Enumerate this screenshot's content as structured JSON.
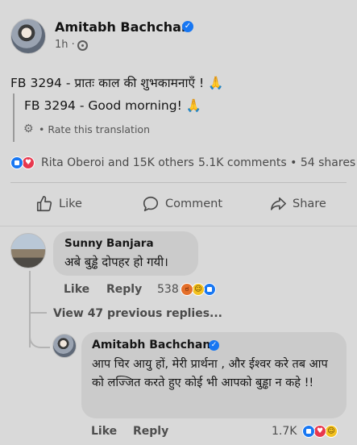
{
  "post": {
    "author": "Amitabh Bachchan",
    "time": "1h",
    "meta_separator": "·",
    "text": "FB 3294 - प्रातः काल की शुभकामनाएँ !",
    "emoji": "🙏",
    "translation": "FB 3294 - Good morning!",
    "rate_translation": "Rate this translation",
    "rate_separator": "•",
    "reactions_summary": "Rita Oberoi and 15K others",
    "comments_shares": "5.1K comments • 54 shares"
  },
  "actions": {
    "like": "Like",
    "comment": "Comment",
    "share": "Share"
  },
  "comment1": {
    "author": "Sunny Banjara",
    "text": "अबे बुड्ढे दोपहर हो गयी।",
    "like": "Like",
    "reply": "Reply",
    "reaction_count": "538"
  },
  "view_previous": "View 47 previous replies...",
  "reply1": {
    "author": "Amitabh Bachchan",
    "text": "आप  चिर आयु हों, मेरी प्रार्थना  , और ईश्वर करे तब आप को लज्जित करते हुए कोई भी आपको बुड्ढा न कहे  !!",
    "like": "Like",
    "reply": "Reply",
    "reaction_count": "1.7K"
  },
  "colors": {
    "background": "#d9d9d9",
    "bubble": "#cbcbcb",
    "accent_blue": "#1877f2",
    "love_red": "#e8384e",
    "haha_yellow": "#f3c11f",
    "angry_orange": "#e46f2a"
  },
  "icons": {
    "verified": "verified-badge-icon",
    "globe": "globe-icon",
    "gear": "gear-icon",
    "like": "thumbs-up-icon",
    "comment": "speech-bubble-icon",
    "share": "share-arrow-icon"
  }
}
